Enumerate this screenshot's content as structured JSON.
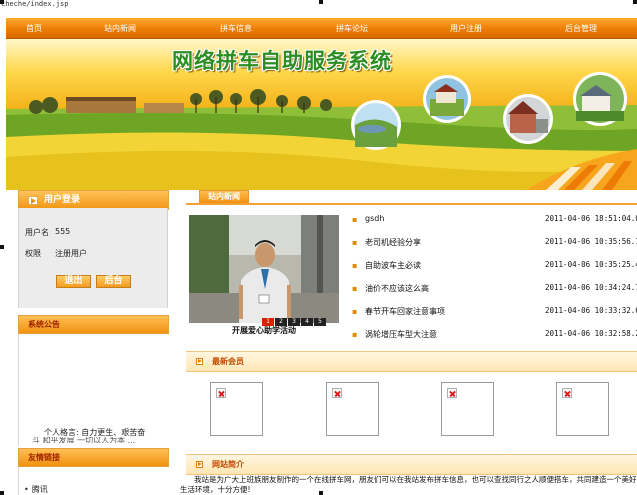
{
  "url_fragment": "cheche/index.jsp",
  "nav": {
    "items": [
      "首页",
      "站内新闻",
      "拼车信息",
      "拼车论坛",
      "用户注册",
      "后台管理"
    ]
  },
  "banner": {
    "title": "网络拼车自助服务系统"
  },
  "login": {
    "title": "用户登录",
    "username_label": "用户名",
    "username_value": "555",
    "role_label": "权限",
    "role_value": "注册用户",
    "logout_label": "退出",
    "admin_label": "后台"
  },
  "notice": {
    "title": "系统公告",
    "motto_line1": "个人格言: 自力更生、艰苦奋",
    "motto_line2": "斗 和平发展 一切以人为本 ..."
  },
  "links": {
    "title": "友情链接",
    "items": [
      "腾讯"
    ]
  },
  "news": {
    "tab_label": "站内新闻",
    "photo_caption": "开展爱心助学活动",
    "slide_numbers": [
      "1",
      "2",
      "3",
      "4",
      "5"
    ],
    "items": [
      {
        "title": "gsdh",
        "date": "2011-04-06 18:51:04.0"
      },
      {
        "title": "老司机经验分享",
        "date": "2011-04-06 10:35:56.17"
      },
      {
        "title": "自助波车主必读",
        "date": "2011-04-06 10:35:25.403"
      },
      {
        "title": "油价不应该这么高",
        "date": "2011-04-06 10:34:24.78"
      },
      {
        "title": "春节开车回家注意事项",
        "date": "2011-04-06 10:33:32.683"
      },
      {
        "title": "涡轮增压车型大注意",
        "date": "2011-04-06 10:32:58.217"
      }
    ]
  },
  "members": {
    "title": "最新会员",
    "count": 4
  },
  "intro": {
    "title": "网站简介",
    "text": "我站是为广大上班族朋友制作的一个在线拼车网，朋友们可以在我站发布拼车信息，也可以查找同行之人顺便搭车，共同建造一个美好生活环境，十分方便!"
  },
  "colors": {
    "accent": "#f08c10",
    "title_green": "#2b8d22"
  }
}
